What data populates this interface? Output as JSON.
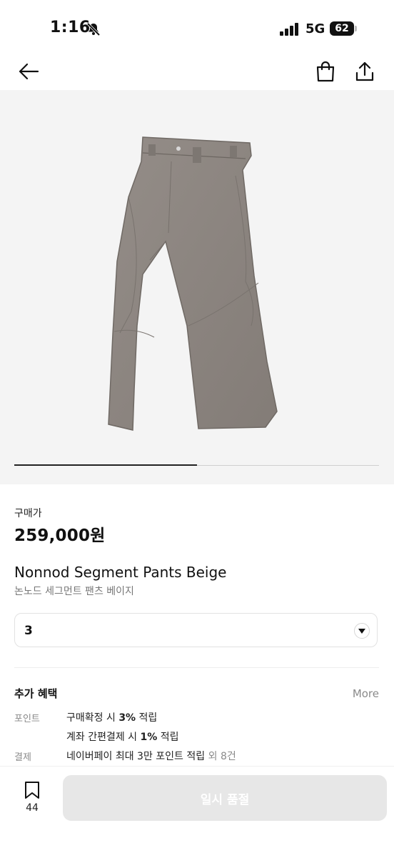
{
  "status_bar": {
    "time": "1:16",
    "network": "5G",
    "battery": "62",
    "icons": [
      "bell-off-icon",
      "signal-icon",
      "battery-icon"
    ]
  },
  "nav": {
    "icons": [
      "back-arrow-icon",
      "shopping-bag-icon",
      "share-icon"
    ]
  },
  "gallery": {
    "current_slide": 1,
    "total_slides": 2
  },
  "product": {
    "price_label": "구매가",
    "price": "259,000원",
    "name": "Nonnod Segment Pants Beige",
    "name_kr": "논노드 세그먼트 팬츠 베이지"
  },
  "size_select": {
    "value": "3"
  },
  "benefits": {
    "title": "추가 혜택",
    "more": "More",
    "point_label": "포인트",
    "point_line1_pre": "구매확정 시 ",
    "point_line1_bold": "3%",
    "point_line1_post": " 적립",
    "point_line2_pre": "계좌 간편결제 시 ",
    "point_line2_bold": "1%",
    "point_line2_post": " 적립",
    "payment_label": "결제",
    "payment_text": "네이버페이 최대 3만 포인트 적립",
    "payment_extra": "외 8건"
  },
  "bottom": {
    "bookmark_count": "44",
    "action_label": "일시 품절"
  },
  "colors": {
    "hero_bg": "#f4f4f4",
    "pants": "#8c8580",
    "disabled_button": "#e7e7e7"
  }
}
